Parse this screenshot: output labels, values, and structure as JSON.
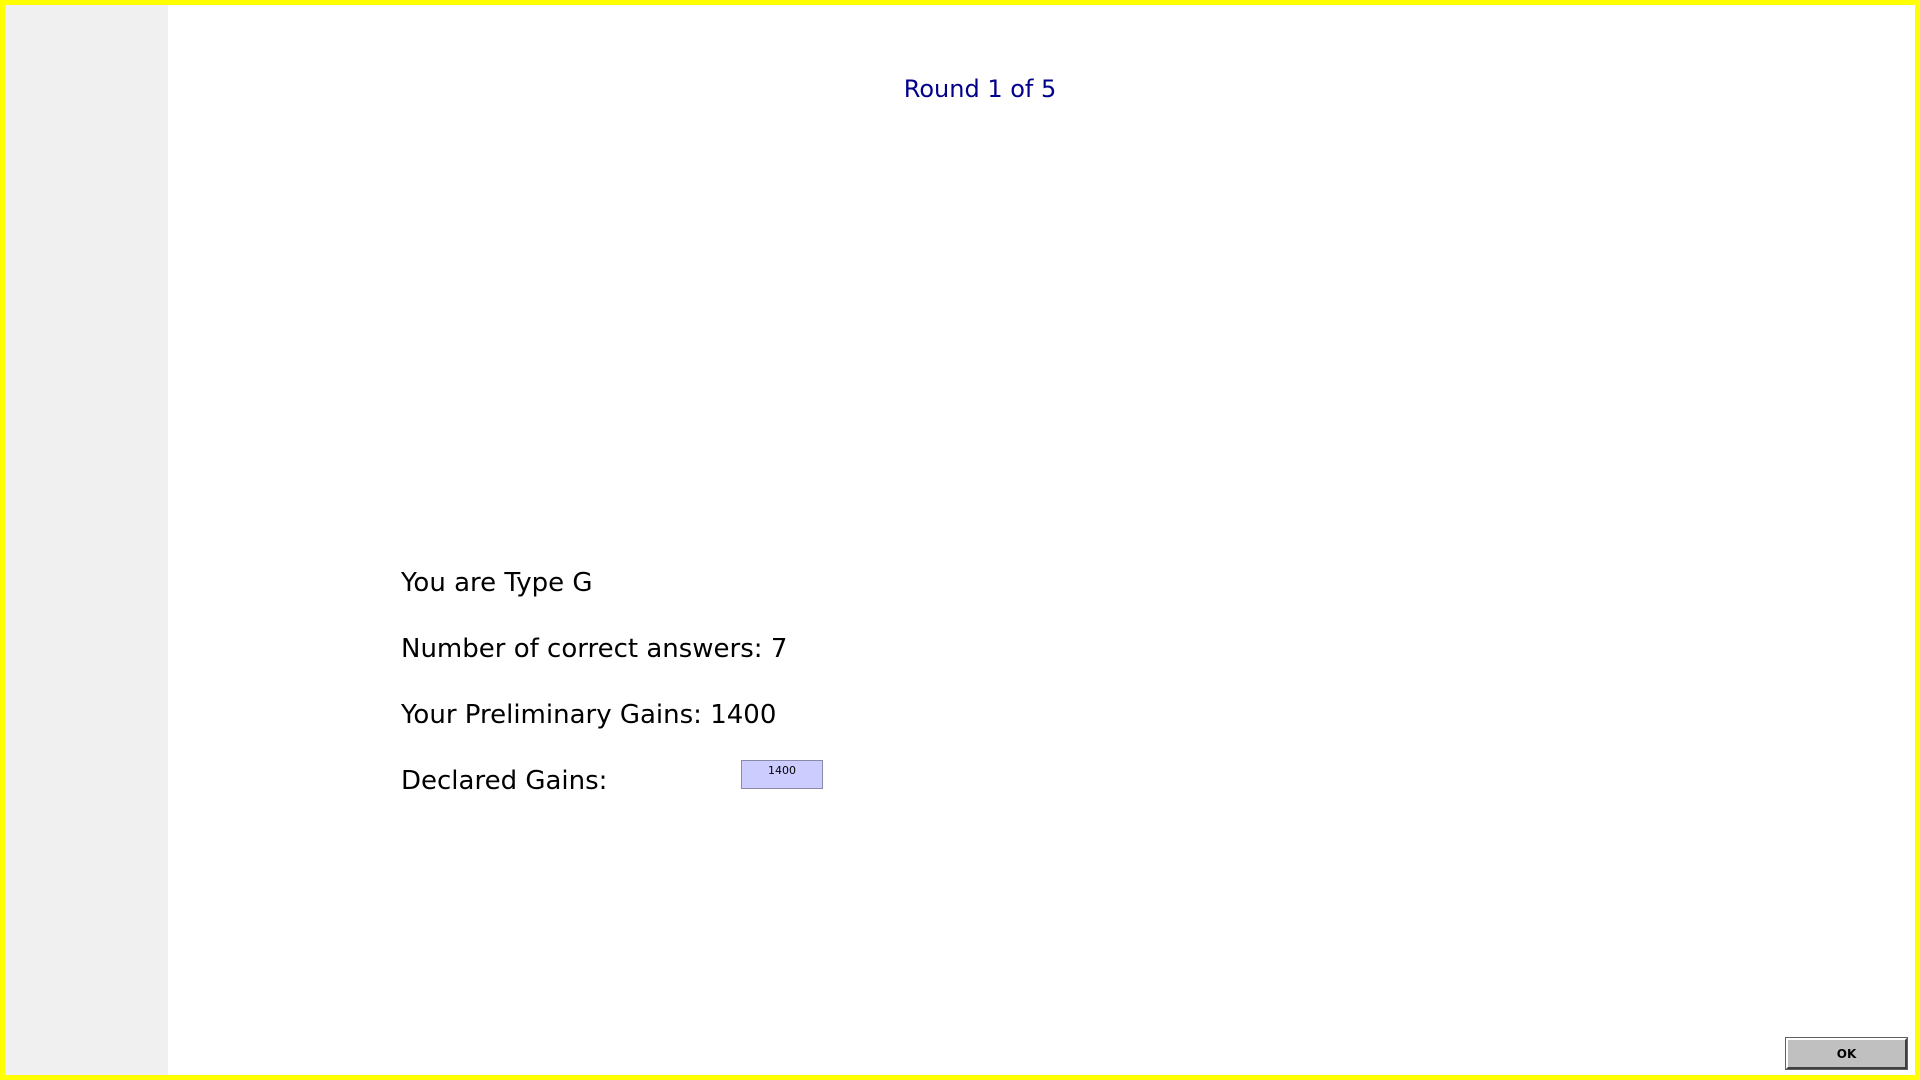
{
  "header": {
    "round_label": "Round 1 of 5"
  },
  "info": {
    "type_line": "You are Type G",
    "correct_answers_line": "Number of correct answers: 7",
    "preliminary_gains_line": "Your Preliminary Gains: 1400",
    "declared_gains_label": "Declared Gains:"
  },
  "form": {
    "declared_gains_value": "1400"
  },
  "actions": {
    "ok_label": "OK"
  },
  "colors": {
    "frame_border": "#ffff00",
    "left_panel": "#f0f0f0",
    "round_text": "#00008b",
    "input_background": "#ccccff",
    "button_face": "#c0c0c0"
  }
}
